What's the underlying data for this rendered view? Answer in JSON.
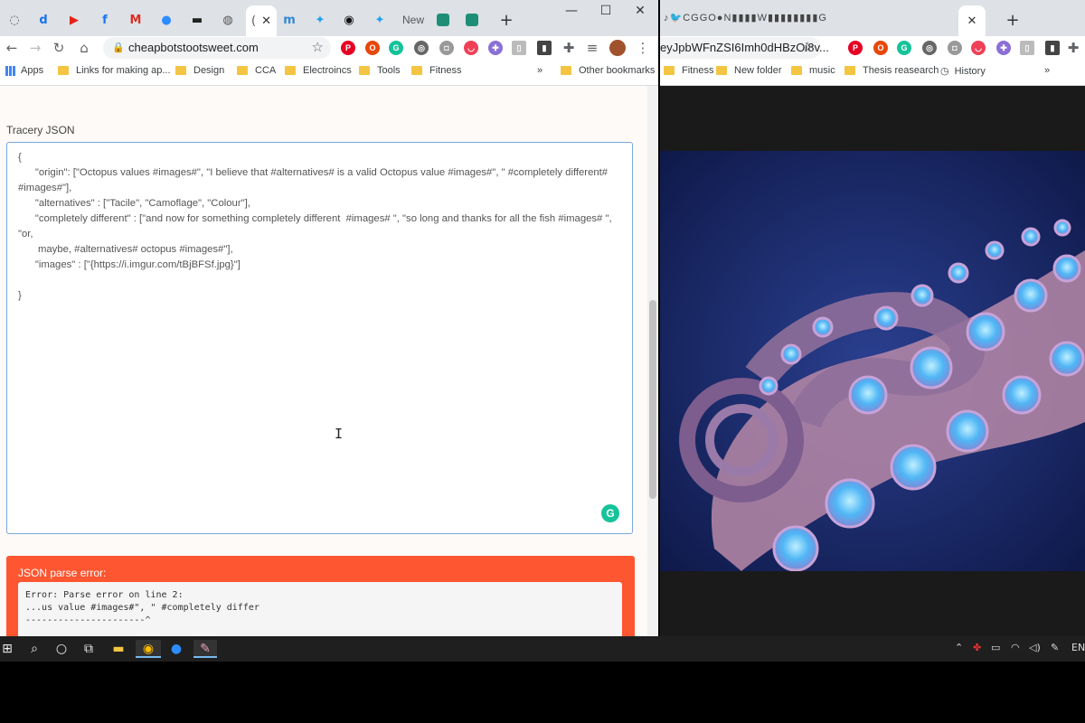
{
  "left_window": {
    "tabs": [
      {
        "icon": "chrome-history-icon",
        "glyph": "◌"
      },
      {
        "icon": "d-logo-icon",
        "glyph": "d"
      },
      {
        "icon": "youtube-icon",
        "glyph": "▶"
      },
      {
        "icon": "facebook-icon",
        "glyph": "f"
      },
      {
        "icon": "gmail-icon",
        "glyph": "M"
      },
      {
        "icon": "zoom-icon",
        "glyph": "●"
      },
      {
        "icon": "car-icon",
        "glyph": "▬"
      },
      {
        "icon": "globe-icon",
        "glyph": "◍"
      },
      {
        "icon": "mastodon-icon",
        "glyph": "m"
      },
      {
        "icon": "twitter-icon",
        "glyph": "✦"
      },
      {
        "icon": "github-icon",
        "glyph": "◉"
      },
      {
        "icon": "twitter-icon",
        "glyph": "✦"
      }
    ],
    "new_tab_label": "New",
    "active_tab_glyph": "(",
    "close_glyph": "✕",
    "window_controls": {
      "minimize": "—",
      "maximize": "☐",
      "close": "✕"
    },
    "url": "cheapbotstootsweet.com",
    "bookmarks": {
      "apps": "Apps",
      "items": [
        "Links for making ap...",
        "Design",
        "CCA",
        "Electroincs",
        "Tools",
        "Fitness"
      ],
      "more": "»",
      "other": "Other bookmarks"
    },
    "section_label": "Tracery JSON",
    "json_text": "{\n      \"origin\": [\"Octopus values #images#\", \"I believe that #alternatives# is a valid Octopus value #images#\", \" #completely different#\n#images#\"],\n      \"alternatives\" : [\"Tacile\", \"Camoflage\", \"Colour\"],\n      \"completely different\" : [\"and now for something completely different  #images# \", \"so long and thanks for all the fish #images# \", \"or,\n       maybe, #alternatives# octopus #images#\"],\n      \"images\" : [\"{https://i.imgur.com/tBjBFSf.jpg}\"]\n\n}",
    "error_title": "JSON parse error:",
    "error_text": "Error: Parse error on line 2:\n...us value #images#\", \" #completely differ\n----------------------^"
  },
  "right_window": {
    "favicon_strip": "♪🐦CGGO●N▮▮▮▮W▮▮▮▮▮▮▮▮G",
    "close_glyph": "✕",
    "new_tab_glyph": "+",
    "url": "eyJpbWFnZSI6Imh0dHBzOi8v...",
    "bookmarks": [
      "Fitness",
      "New folder",
      "music",
      "Thesis reasearch"
    ],
    "history": "History",
    "more": "»"
  },
  "taskbar": {
    "language": "EN"
  },
  "colors": {
    "error_bg": "#fd5631",
    "editor_border": "#7aa7e0",
    "grammarly": "#15c39a",
    "page_bg": "#fdfaf7"
  }
}
